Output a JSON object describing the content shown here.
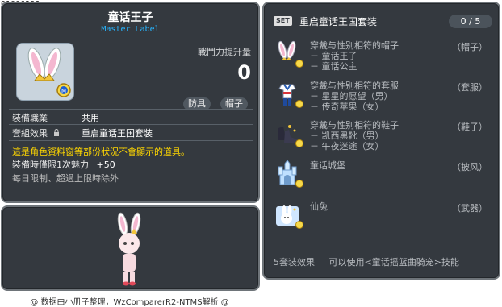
{
  "item_id": "01006386",
  "item": {
    "name": "童话王子",
    "label": "Master Label",
    "stat_label": "戰鬥力提升量",
    "stat_value": "0",
    "tags": [
      "防具",
      "帽子"
    ],
    "job_label": "裝備職業",
    "job_value": "共用",
    "set_label": "套組效果",
    "set_value": "重启童话王国套装",
    "warning": "這是角色資料窗等部份狀況不會顯示的道具。",
    "charm_line": "裝備時僅限1次魅力",
    "charm_value": "+50",
    "daily_limit": "每日限制、超過上限時除外"
  },
  "set": {
    "badge": "SET",
    "title": "重启童话王国套装",
    "count": "0 / 5",
    "items": [
      {
        "name": "穿戴与性别相符的帽子",
        "slot": "（帽子）",
        "options": [
          "－ 童话王子",
          "－ 童话公主"
        ],
        "icon": "bunny-ears-hat-icon"
      },
      {
        "name": "穿戴与性别相符的套服",
        "slot": "（套服）",
        "options": [
          "－ 星星的愿望（男）",
          "－ 传奇苹果（女）"
        ],
        "icon": "sailor-outfit-icon"
      },
      {
        "name": "穿戴与性别相符的鞋子",
        "slot": "（鞋子）",
        "options": [
          "－ 凯西黑靴（男）",
          "－ 午夜迷途（女）"
        ],
        "icon": "black-shoes-icon"
      },
      {
        "name": "童话城堡",
        "slot": "（披风）",
        "options": [],
        "icon": "castle-cape-icon"
      },
      {
        "name": "仙兔",
        "slot": "（武器）",
        "options": [],
        "icon": "bunny-weapon-icon"
      }
    ],
    "footer_label": "5套装效果",
    "footer_value": "可以使用<童话摇篮曲骑宠>技能"
  },
  "credit": "@ 数据由小册子整理，WzComparerR2-NTMS解析 @"
}
